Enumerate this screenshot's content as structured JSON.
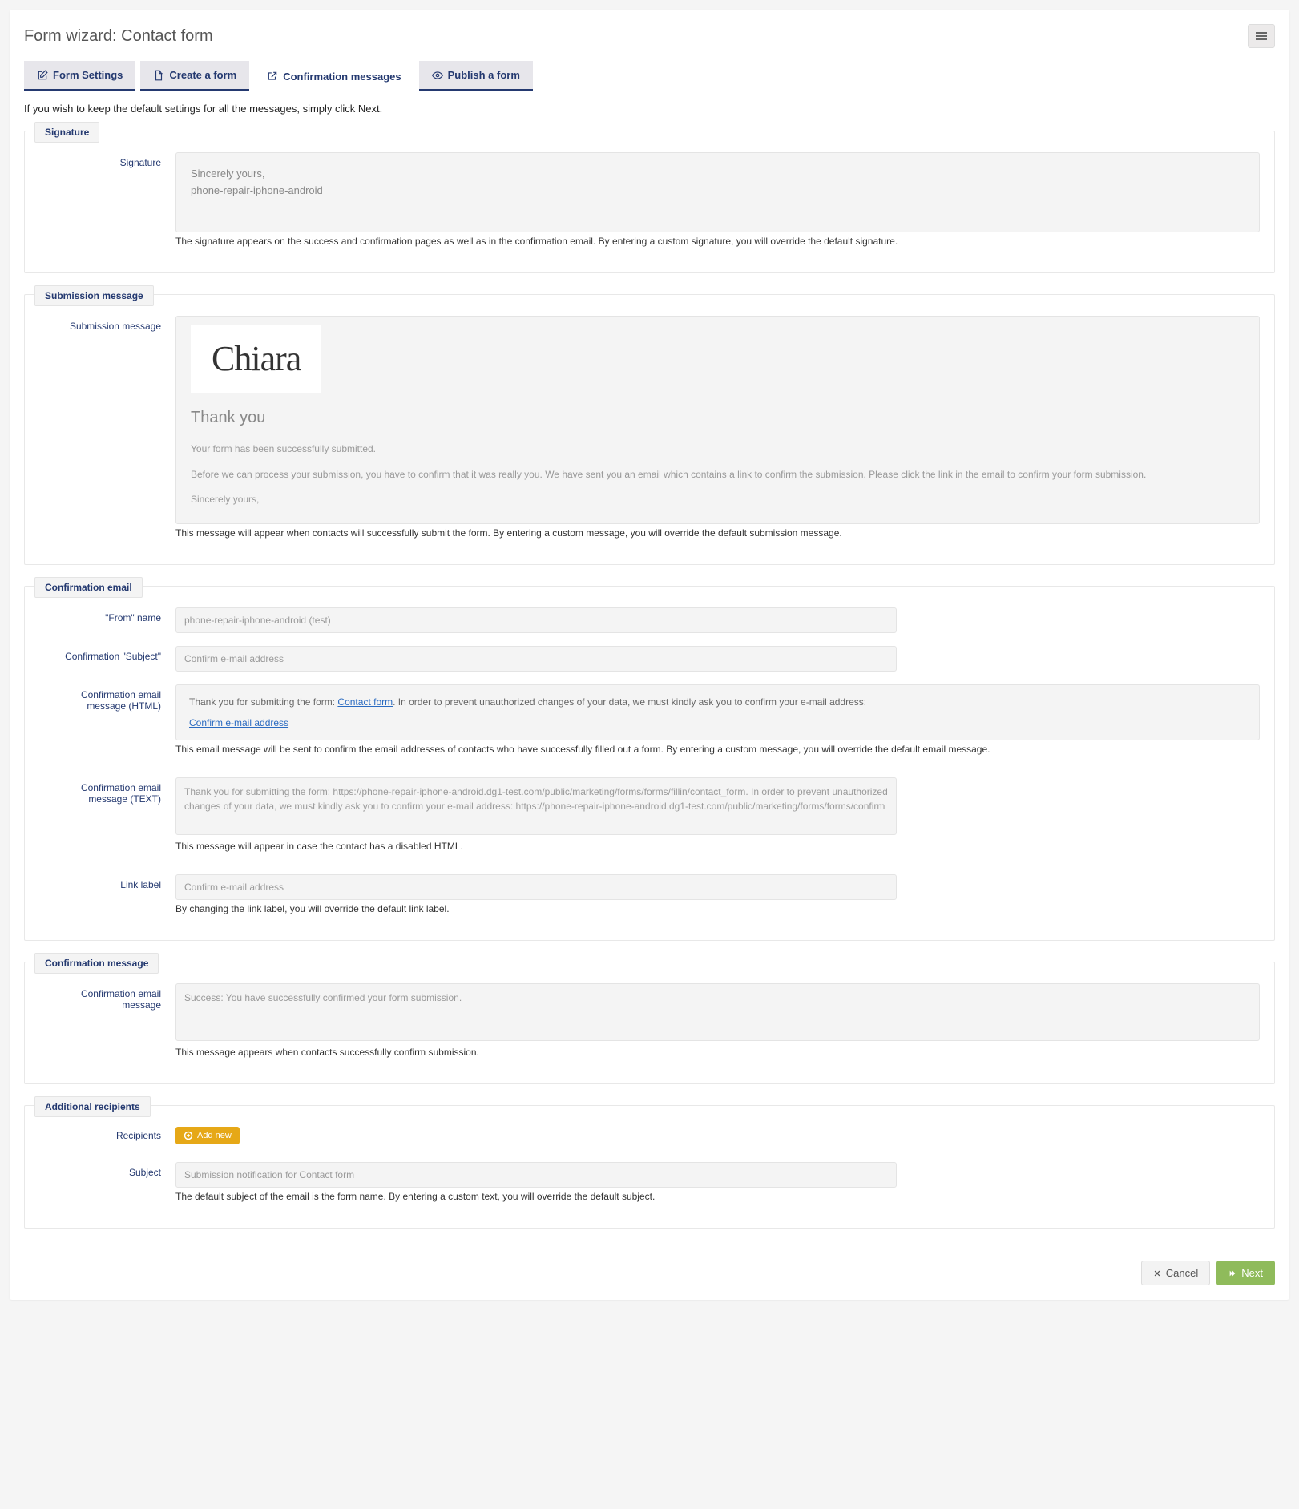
{
  "title": "Form wizard: Contact form",
  "tabs": [
    {
      "label": "Form Settings"
    },
    {
      "label": "Create a form"
    },
    {
      "label": "Confirmation messages"
    },
    {
      "label": "Publish a form"
    }
  ],
  "intro": "If you wish to keep the default settings for all the messages, simply click Next.",
  "signature": {
    "legend": "Signature",
    "label": "Signature",
    "line1": "Sincerely yours,",
    "line2": "phone-repair-iphone-android",
    "help": "The signature appears on the success and confirmation pages as well as in the confirmation email. By entering a custom signature, you will override the default signature."
  },
  "submission": {
    "legend": "Submission message",
    "label": "Submission message",
    "brand": "Chiara",
    "thank": "Thank you",
    "p1": "Your form has been successfully submitted.",
    "p2": "Before we can process your submission, you have to confirm that it was really you. We have sent you an email which contains a link to confirm the submission. Please click the link in the email to confirm your form submission.",
    "p3": "Sincerely yours,",
    "help": "This message will appear when contacts will successfully submit the form. By entering a custom message, you will override the default submission message."
  },
  "confirmation_email": {
    "legend": "Confirmation email",
    "from_label": "\"From\" name",
    "from_placeholder": "phone-repair-iphone-android (test)",
    "subject_label": "Confirmation \"Subject\"",
    "subject_placeholder": "Confirm e-mail address",
    "html_label": "Confirmation email message (HTML)",
    "html_prefix": "Thank you for submitting the form: ",
    "html_formlink": "Contact form",
    "html_suffix": ". In order to prevent unauthorized changes of your data, we must kindly ask you to confirm your e-mail address:",
    "html_confirm_link": "Confirm e-mail address",
    "html_help": "This email message will be sent to confirm the email addresses of contacts who have successfully filled out a form. By entering a custom message, you will override the default email message.",
    "text_label": "Confirmation email message (TEXT)",
    "text_placeholder": "Thank you for submitting the form: https://phone-repair-iphone-android.dg1-test.com/public/marketing/forms/forms/fillin/contact_form. In order to prevent unauthorized changes of your data, we must kindly ask you to confirm your e-mail address: https://phone-repair-iphone-android.dg1-test.com/public/marketing/forms/forms/confirm",
    "text_help": "This message will appear in case the contact has a disabled HTML.",
    "linklabel_label": "Link label",
    "linklabel_placeholder": "Confirm e-mail address",
    "linklabel_help": "By changing the link label, you will override the default link label."
  },
  "confirmation_message": {
    "legend": "Confirmation message",
    "label": "Confirmation email message",
    "placeholder": "Success: You have successfully confirmed your form submission.",
    "help": "This message appears when contacts successfully confirm submission."
  },
  "additional": {
    "legend": "Additional recipients",
    "recipients_label": "Recipients",
    "add_label": "Add new",
    "subject_label": "Subject",
    "subject_placeholder": "Submission notification for Contact form",
    "subject_help": "The default subject of the email is the form name. By entering a custom text, you will override the default subject."
  },
  "footer": {
    "cancel": "Cancel",
    "next": "Next"
  }
}
